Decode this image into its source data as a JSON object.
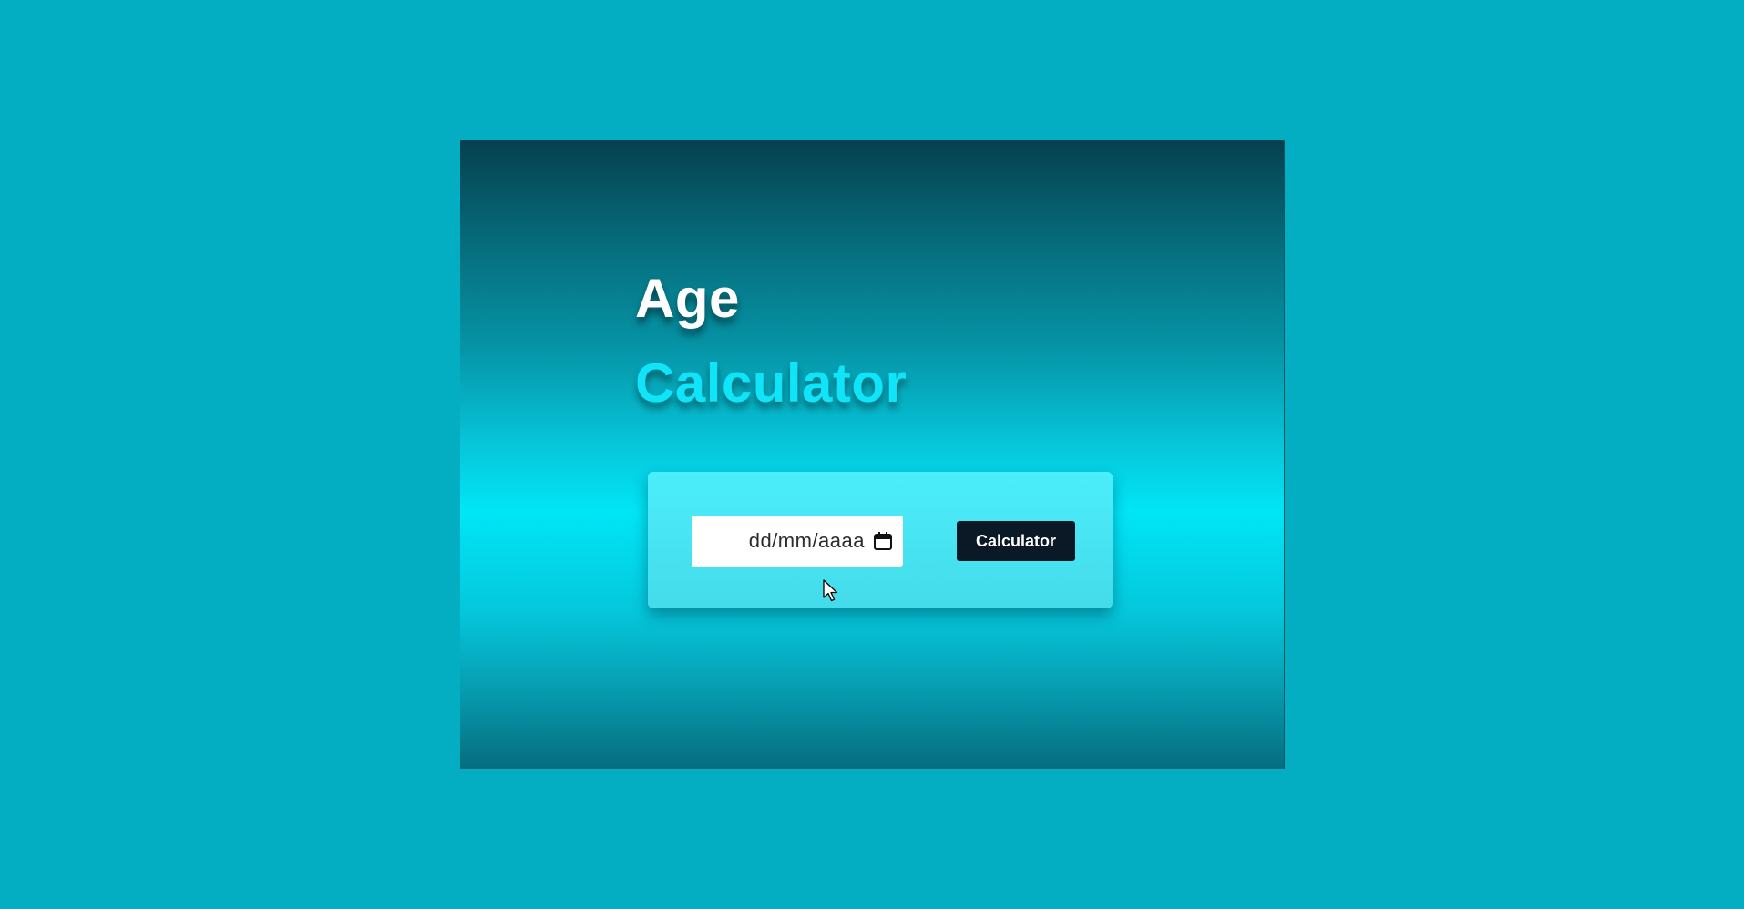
{
  "app": {
    "title_line1": "Age",
    "title_line2": "Calculator"
  },
  "form": {
    "date_placeholder": "dd/mm/aaaa",
    "date_value": "",
    "submit_label": "Calculator"
  },
  "icons": {
    "date_picker": "calendar-icon",
    "pointer": "cursor-icon"
  },
  "colors": {
    "page_background": "#03aec3",
    "title_primary": "#ffffff",
    "title_accent": "#10e4f8",
    "card_background": "#4ceefc",
    "button_background": "#0b1826",
    "button_text": "#ffffff"
  }
}
